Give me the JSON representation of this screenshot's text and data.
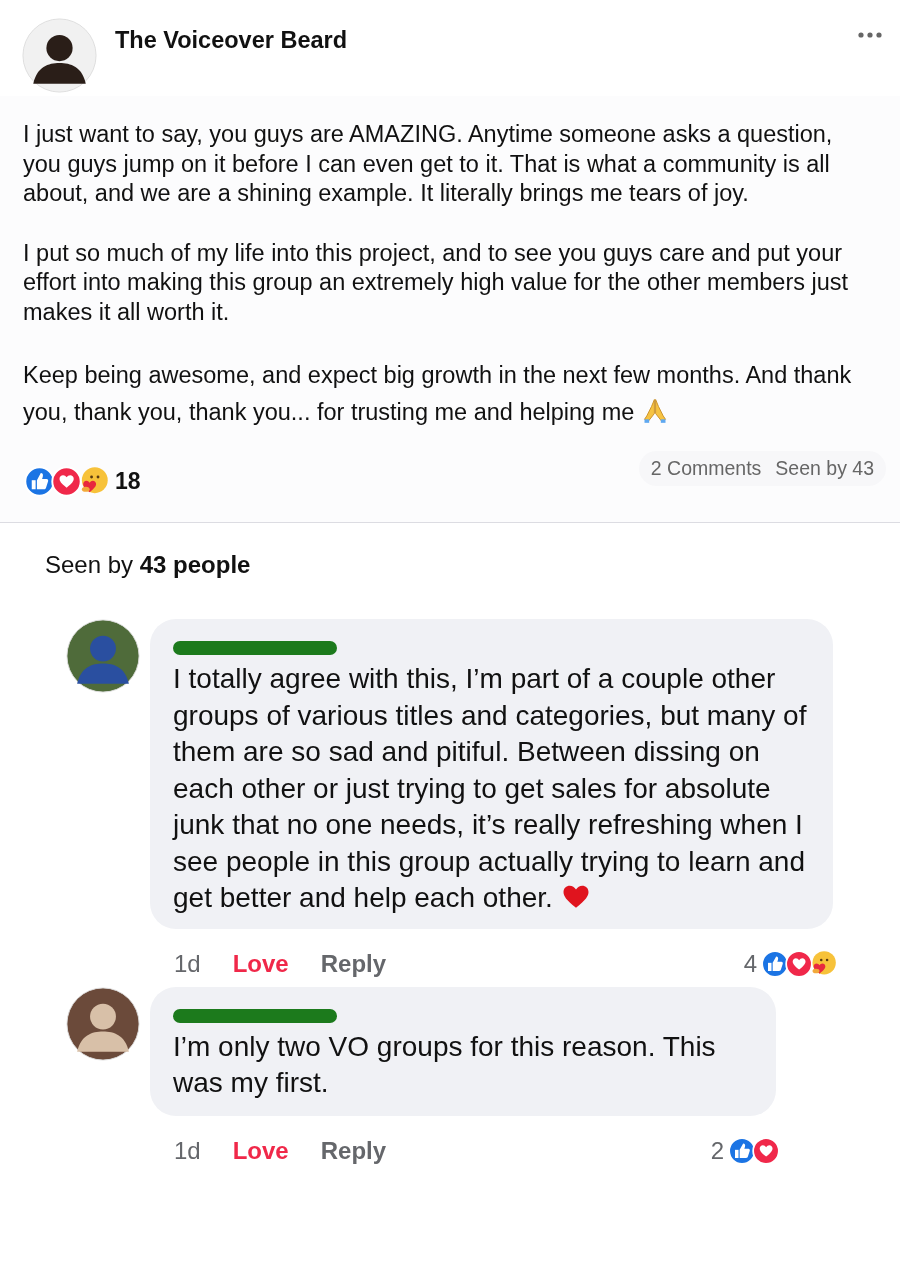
{
  "post": {
    "author": "The Voiceover Beard",
    "paragraphs": [
      "I just want to say, you guys are AMAZING. Anytime someone asks a question, you guys jump on it before I can even get to it. That is what a community is all about, and we are a shining example. It literally brings me tears of joy.",
      "I put so much of my life into this project, and to see you guys care and put your effort into making this group an extremely high value for the other members just makes it all worth it.",
      "Keep being awesome, and expect big growth in the next few months. And thank you, thank you, thank you... for trusting me and helping me"
    ],
    "reactions": [
      {
        "kind": "like"
      },
      {
        "kind": "love"
      },
      {
        "kind": "care"
      }
    ],
    "reaction_count": "18",
    "comments_count": "2 Comments",
    "seen_short": "Seen by 43"
  },
  "seen_by": "Seen by **43 people**",
  "comments": [
    {
      "name_redacted": true,
      "text": "I totally agree with this, I’m part of a couple other groups of various titles and categories, but many of them are so sad and pitiful. Between dissing on each other or just trying to get sales for absolute junk that no one needs, it’s really refreshing when I see people in this group actually trying to learn and get better and help each other.",
      "ends_with_heart": true,
      "time": "1d",
      "love_label": "Love",
      "loved": true,
      "reply_label": "Reply",
      "reaction_count": "4",
      "reactions": [
        {
          "kind": "like"
        },
        {
          "kind": "love"
        },
        {
          "kind": "care"
        }
      ]
    },
    {
      "name_redacted": true,
      "text": "I’m only two VO groups for this reason. This was my first.",
      "time": "1d",
      "love_label": "Love",
      "loved": true,
      "reply_label": "Reply",
      "reaction_count": "2",
      "reactions": [
        {
          "kind": "like"
        },
        {
          "kind": "love"
        }
      ]
    }
  ]
}
